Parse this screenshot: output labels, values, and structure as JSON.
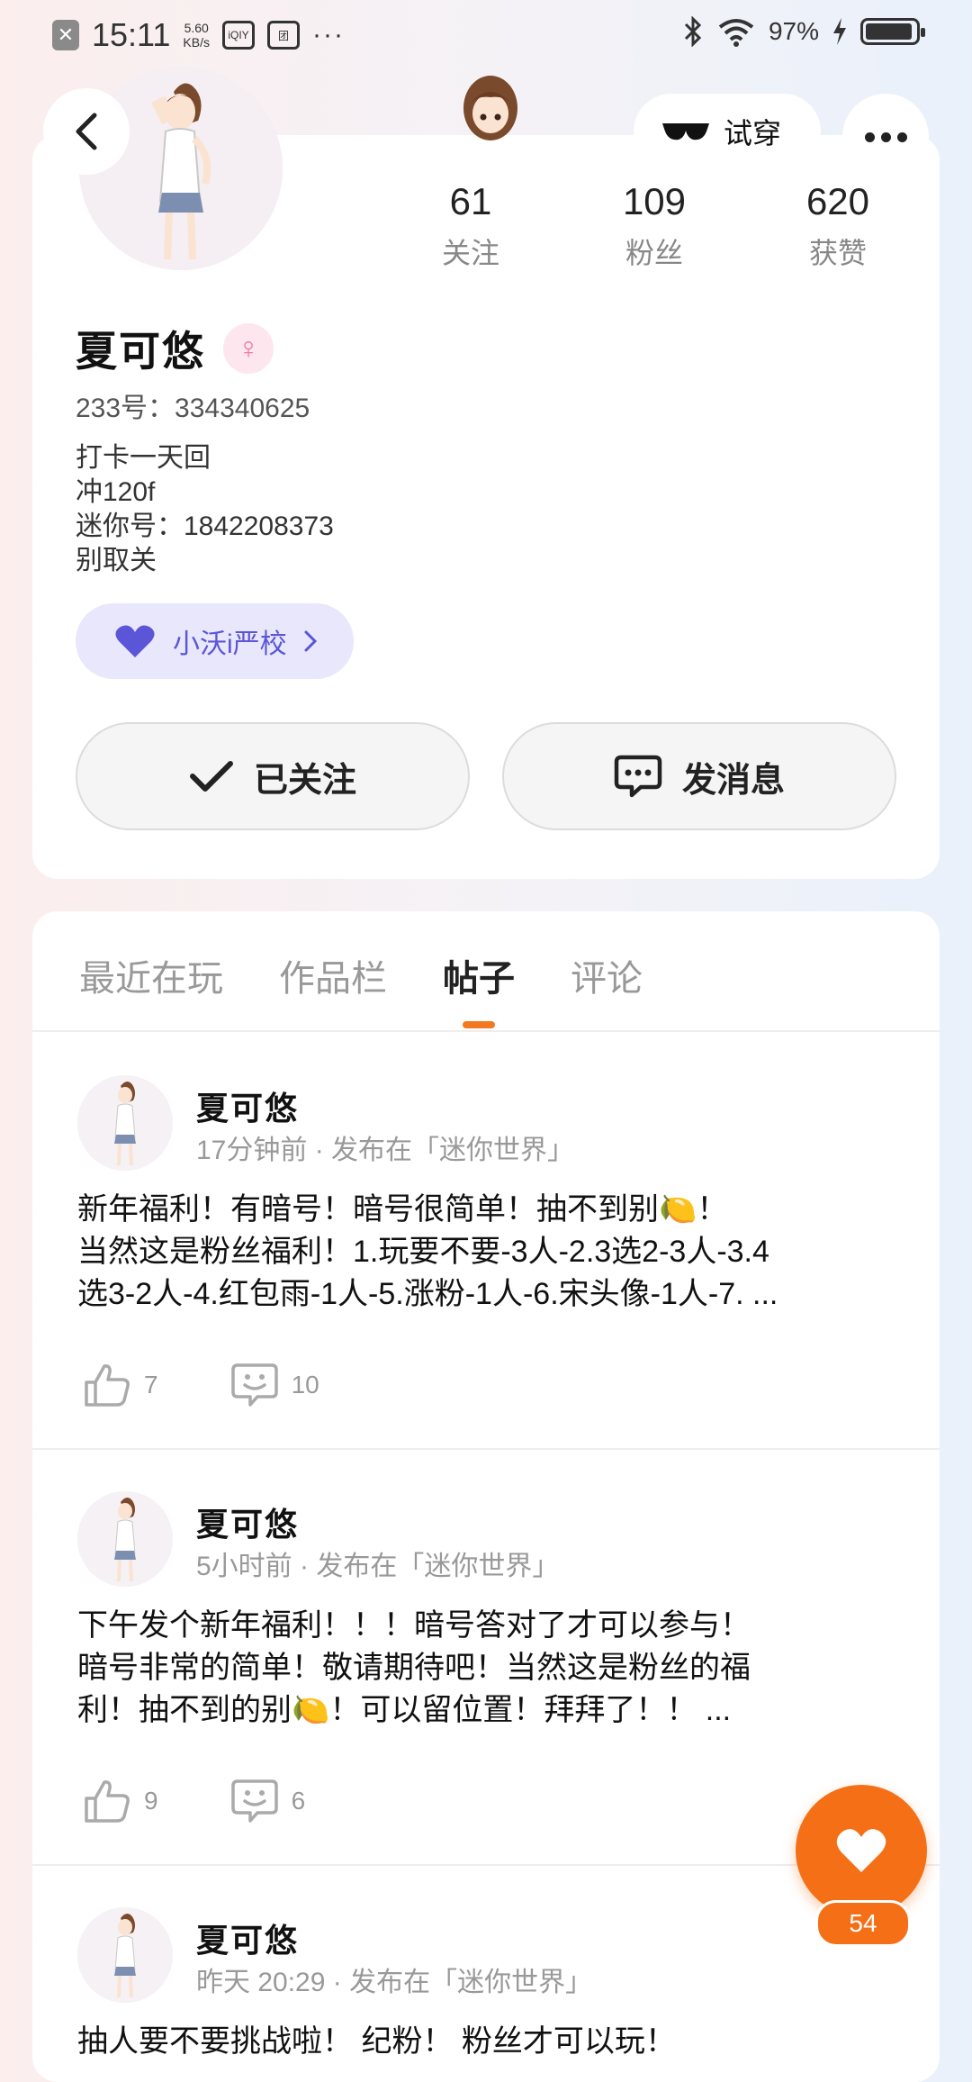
{
  "status_bar": {
    "time": "15:11",
    "speed_value": "5.60",
    "speed_unit": "KB/s",
    "battery": "97%"
  },
  "header": {
    "try_label": "试穿"
  },
  "profile": {
    "name": "夏可悠",
    "gender_symbol": "♀",
    "uid": "233号：334340625",
    "bio": [
      "打卡一天回",
      "冲120f",
      "迷你号：1842208373",
      "别取关"
    ],
    "school_label": "小沃i严校",
    "stats": [
      {
        "value": "61",
        "label": "关注"
      },
      {
        "value": "109",
        "label": "粉丝"
      },
      {
        "value": "620",
        "label": "获赞"
      }
    ],
    "follow_label": "已关注",
    "message_label": "发消息"
  },
  "tabs": [
    "最近在玩",
    "作品栏",
    "帖子",
    "评论"
  ],
  "active_tab": "帖子",
  "posts": [
    {
      "author": "夏可悠",
      "meta": "17分钟前 · 发布在「迷你世界」",
      "lines": [
        "新年福利！有暗号！暗号很简单！抽不到别🍋！",
        "当然这是粉丝福利！1.玩要不要-3人-2.3选2-3人-3.4",
        "选3-2人-4.红包雨-1人-5.涨粉-1人-6.宋头像-1人-7. ..."
      ],
      "likes": "7",
      "comments": "10"
    },
    {
      "author": "夏可悠",
      "meta": "5小时前 · 发布在「迷你世界」",
      "lines": [
        "下午发个新年福利！！！暗号答对了才可以参与！",
        "暗号非常的简单！敬请期待吧！当然这是粉丝的福",
        "利！抽不到的别🍋！可以留位置！拜拜了！！ ..."
      ],
      "likes": "9",
      "comments": "6"
    },
    {
      "author": "夏可悠",
      "meta": "昨天 20:29 · 发布在「迷你世界」",
      "lines": [
        "抽人要不要挑战啦！ 纪粉！ 粉丝才可以玩！"
      ],
      "likes": "",
      "comments": ""
    }
  ],
  "fab": {
    "count": "54"
  },
  "colors": {
    "accent": "#f46f16",
    "school_text": "#5b55d8",
    "school_bg": "#e8e7fb",
    "gender_pink": "#f07aa3"
  }
}
